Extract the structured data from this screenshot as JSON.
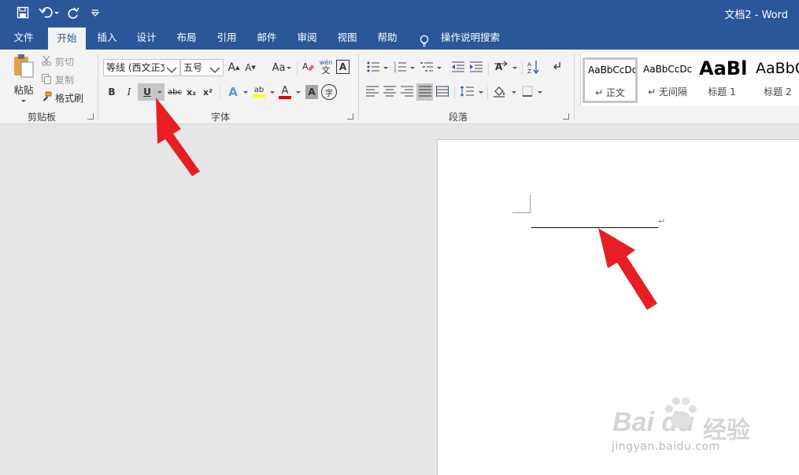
{
  "titlebar": {
    "title": "文档2  -  Word",
    "save_icon": "save-icon",
    "undo_icon": "undo-icon",
    "redo_icon": "redo-icon",
    "customize_icon": "customize-quick-access-icon"
  },
  "tabs": [
    {
      "label": "文件"
    },
    {
      "label": "开始",
      "active": true
    },
    {
      "label": "插入"
    },
    {
      "label": "设计"
    },
    {
      "label": "布局"
    },
    {
      "label": "引用"
    },
    {
      "label": "邮件"
    },
    {
      "label": "审阅"
    },
    {
      "label": "视图"
    },
    {
      "label": "帮助"
    },
    {
      "label": "操作说明搜索",
      "icon": "lightbulb-icon"
    }
  ],
  "clipboard": {
    "paste_label": "粘贴",
    "cut_label": "剪切",
    "copy_label": "复制",
    "format_painter_label": "格式刷",
    "group_label": "剪贴板"
  },
  "font": {
    "font_name": "等线 (西文正文",
    "font_size": "五号",
    "grow_glyph": "A",
    "shrink_glyph": "A",
    "case_glyph": "Aa",
    "phonetic_top": "wén",
    "phonetic_bottom": "文",
    "border_glyph": "A",
    "bold_glyph": "B",
    "italic_glyph": "I",
    "underline_glyph": "U",
    "strike_glyph": "abc",
    "subscript_glyph": "x₂",
    "superscript_glyph": "x²",
    "effect_glyph": "A",
    "highlight_glyph": "ab",
    "color_glyph": "A",
    "shade_glyph": "A",
    "enclose_glyph": "字",
    "group_label": "字体"
  },
  "paragraph": {
    "group_label": "段落"
  },
  "styles": [
    {
      "sample": "AaBbCcDc",
      "name": "↵ 正文",
      "selected": true
    },
    {
      "sample": "AaBbCcDc",
      "name": "↵ 无间隔"
    },
    {
      "sample": "AaBl",
      "name": "标题 1"
    },
    {
      "sample": "AaBbC",
      "name": "标题 2"
    }
  ],
  "document": {
    "paragraph_mark": "↵"
  },
  "watermark": {
    "brand": "Bai du",
    "jingyan": "经验",
    "url": "jingyan.baidu.com"
  },
  "colors": {
    "brand_blue": "#2b579a",
    "ribbon_bg": "#f3f3f3",
    "arrow_red": "#e81e25",
    "font_color_red": "#e00000",
    "highlight_yellow": "#ffff00"
  }
}
